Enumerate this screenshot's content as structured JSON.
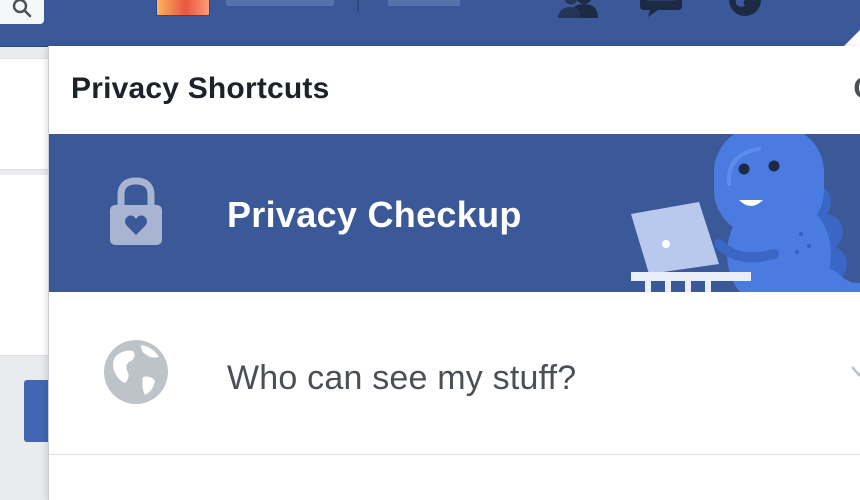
{
  "header": {
    "title": "Privacy Shortcuts",
    "settings_partial": "C"
  },
  "rows": [
    {
      "label": "Privacy Checkup",
      "icon": "lock-icon",
      "highlighted": true
    },
    {
      "label": "Who can see my stuff?",
      "icon": "globe-icon",
      "highlighted": false
    }
  ],
  "topbar": {
    "icons": [
      "search-icon",
      "friends-icon",
      "messages-icon",
      "globe-icon"
    ]
  },
  "colors": {
    "brand_blue": "#3b5998",
    "dino_blue": "#4a7be0",
    "text_dark": "#1d2129",
    "text_gray": "#4b4f56",
    "icon_gray": "#bec3c9"
  }
}
